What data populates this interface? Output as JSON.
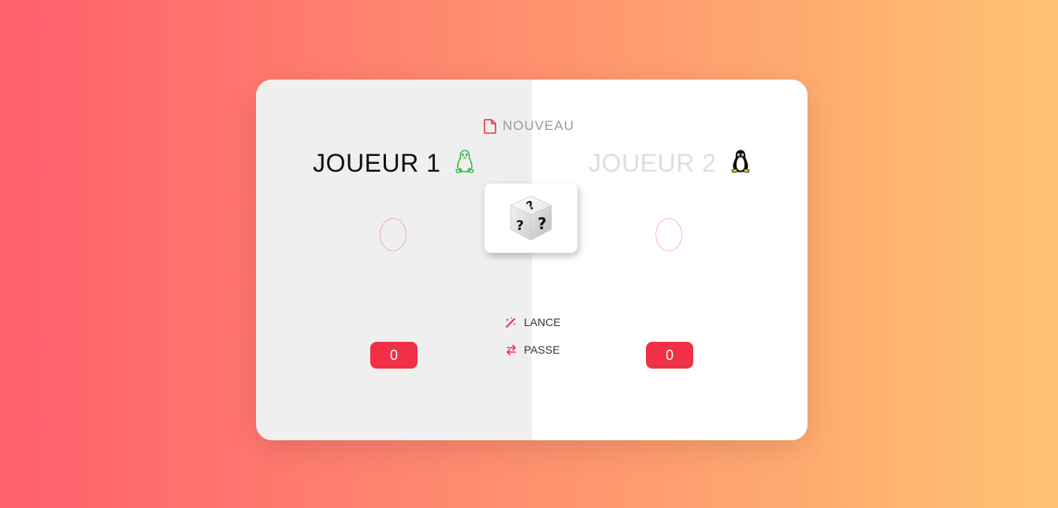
{
  "game": {
    "new_label": "NOUVEAU",
    "roll_label": "LANCE",
    "hold_label": "PASSE"
  },
  "players": [
    {
      "name": "JOUEUR 1",
      "current": "",
      "score": "0",
      "active": true,
      "icon": "penguin-icon"
    },
    {
      "name": "JOUEUR 2",
      "current": "",
      "score": "0",
      "active": false,
      "icon": "penguin-icon"
    }
  ],
  "dice": {
    "icon": "question-dice-icon"
  },
  "colors": {
    "accent": "#f03046",
    "gradient_start": "#ff5f6d",
    "gradient_end": "#ffc371",
    "active_panel": "#efefef",
    "inactive_name": "#dedede",
    "active_tux": "#2fbf3a"
  }
}
